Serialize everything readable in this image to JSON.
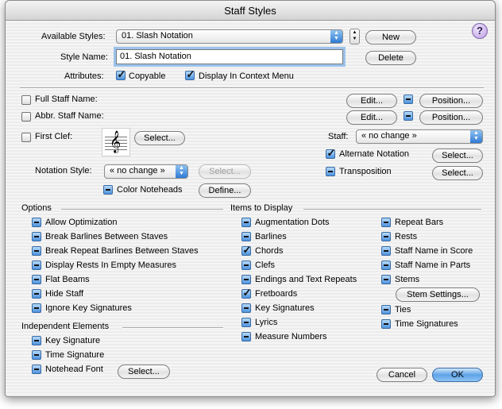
{
  "window": {
    "title": "Staff Styles",
    "help_label": "?"
  },
  "top": {
    "available_label": "Available Styles:",
    "available_value": "01.  Slash Notation",
    "new_label": "New",
    "style_name_label": "Style Name:",
    "style_name_value": "01.  Slash Notation",
    "delete_label": "Delete",
    "attributes_label": "Attributes:",
    "copyable_label": "Copyable",
    "context_menu_label": "Display In Context Menu"
  },
  "staff_section": {
    "full_staff_name": "Full Staff Name:",
    "abbr_staff_name": "Abbr. Staff Name:",
    "edit_label": "Edit...",
    "position_label": "Position...",
    "first_clef": "First Clef:",
    "select_label": "Select...",
    "staff_label": "Staff:",
    "staff_value": "« no change »",
    "alternate_notation": "Alternate Notation",
    "transposition": "Transposition",
    "notation_style_label": "Notation Style:",
    "notation_style_value": "« no change »",
    "color_noteheads": "Color Noteheads",
    "define_label": "Define...",
    "clef_glyph": "𝄞"
  },
  "options": {
    "header": "Options",
    "items": [
      "Allow Optimization",
      "Break Barlines Between Staves",
      "Break Repeat Barlines Between Staves",
      "Display Rests In Empty Measures",
      "Flat Beams",
      "Hide Staff",
      "Ignore Key Signatures"
    ]
  },
  "independent": {
    "header": "Independent Elements",
    "items": [
      "Key Signature",
      "Time Signature",
      "Notehead Font"
    ],
    "select_label": "Select..."
  },
  "display": {
    "header": "Items to Display",
    "col1": [
      "Augmentation Dots",
      "Barlines",
      "Chords",
      "Clefs",
      "Endings and Text Repeats",
      "Fretboards",
      "Key Signatures",
      "Lyrics",
      "Measure Numbers"
    ],
    "col2": [
      "Repeat Bars",
      "Rests",
      "Staff Name in Score",
      "Staff Name in Parts",
      "Stems"
    ],
    "stem_settings_label": "Stem Settings...",
    "col2b": [
      "Ties",
      "Time Signatures"
    ]
  },
  "footer": {
    "cancel_label": "Cancel",
    "ok_label": "OK"
  }
}
